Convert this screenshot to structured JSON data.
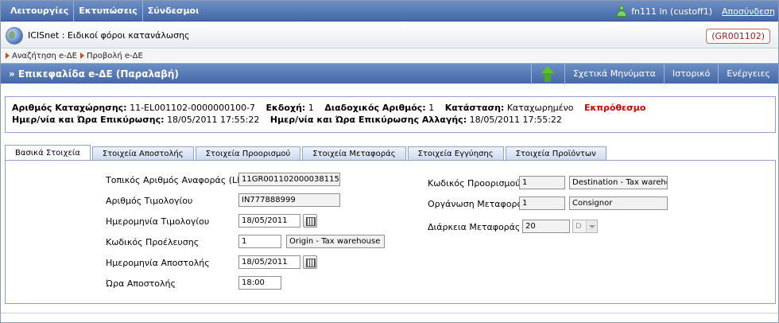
{
  "topbar": {
    "menu": [
      "Λειτουργίες",
      "Εκτυπώσεις",
      "Σύνδεσμοι"
    ],
    "user": "fn111 ln (custoff1)",
    "logout": "Αποσύνδεση",
    "user_icon": "user-icon"
  },
  "app": {
    "title": "ICISnet : Ειδικοί φόροι κατανάλωσης",
    "ref_code": "(GR001102)",
    "icon": "globe-icon"
  },
  "breadcrumb": [
    "Αναζήτηση e-ΔΕ",
    "Προβολή e-ΔΕ"
  ],
  "header": {
    "title": "» Επικεφαλίδα e-ΔΕ (Παραλαβή)",
    "actions": [
      "Σχετικά Μηνύματα",
      "Ιστορικό",
      "Ενέργειες"
    ],
    "up_icon": "arrow-up-icon"
  },
  "info": {
    "reg_no_label": "Αριθμός Καταχώρησης:",
    "reg_no": "11-EL001102-0000000100-7",
    "version_label": "Εκδοχή:",
    "version": "1",
    "seq_label": "Διαδοχικός Αριθμός:",
    "seq": "1",
    "status_label": "Κατάσταση:",
    "status": "Καταχωρημένο",
    "status_flag": "Εκπρόθεσμο",
    "validation_label": "Ημερ/νία και Ώρα Επικύρωσης:",
    "validation": "18/05/2011 17:55:22",
    "change_validation_label": "Ημερ/νία και Ώρα Επικύρωσης Αλλαγής:",
    "change_validation": "18/05/2011 17:55:22",
    "status_flag_color": "#d00000"
  },
  "tabs": [
    "Βασικά Στοιχεία",
    "Στοιχεία Αποστολής",
    "Στοιχεία Προορισμού",
    "Στοιχεία Μεταφοράς",
    "Στοιχεία Εγγύησης",
    "Στοιχεία Προϊόντων"
  ],
  "form_left": {
    "lrn_label": "Τοπικός Αριθμός Αναφοράς (LRN)",
    "lrn": "11GR001102000038115",
    "invoice_no_label": "Αριθμός Τιμολογίου",
    "invoice_no": "IN777888999",
    "invoice_date_label": "Ημερομηνία Τιμολογίου",
    "invoice_date": "18/05/2011",
    "origin_code_label": "Κωδικός Προέλευσης",
    "origin_code": "1",
    "origin_desc": "Origin - Tax warehouse",
    "dispatch_date_label": "Ημερομηνία Αποστολής",
    "dispatch_date": "18/05/2011",
    "dispatch_time_label": "Ώρα Αποστολής",
    "dispatch_time": "18:00"
  },
  "form_right": {
    "dest_code_label": "Κωδικός Προορισμού",
    "dest_code": "1",
    "dest_desc": "Destination - Tax wareho",
    "transport_org_label": "Οργάνωση Μεταφοράς",
    "transport_org": "1",
    "transport_org_desc": "Consignor",
    "duration_label": "Διάρκεια Μεταφοράς",
    "duration": "20",
    "duration_unit": "D"
  },
  "colors": {
    "accent": "#4468a8",
    "alert": "#d00000"
  }
}
